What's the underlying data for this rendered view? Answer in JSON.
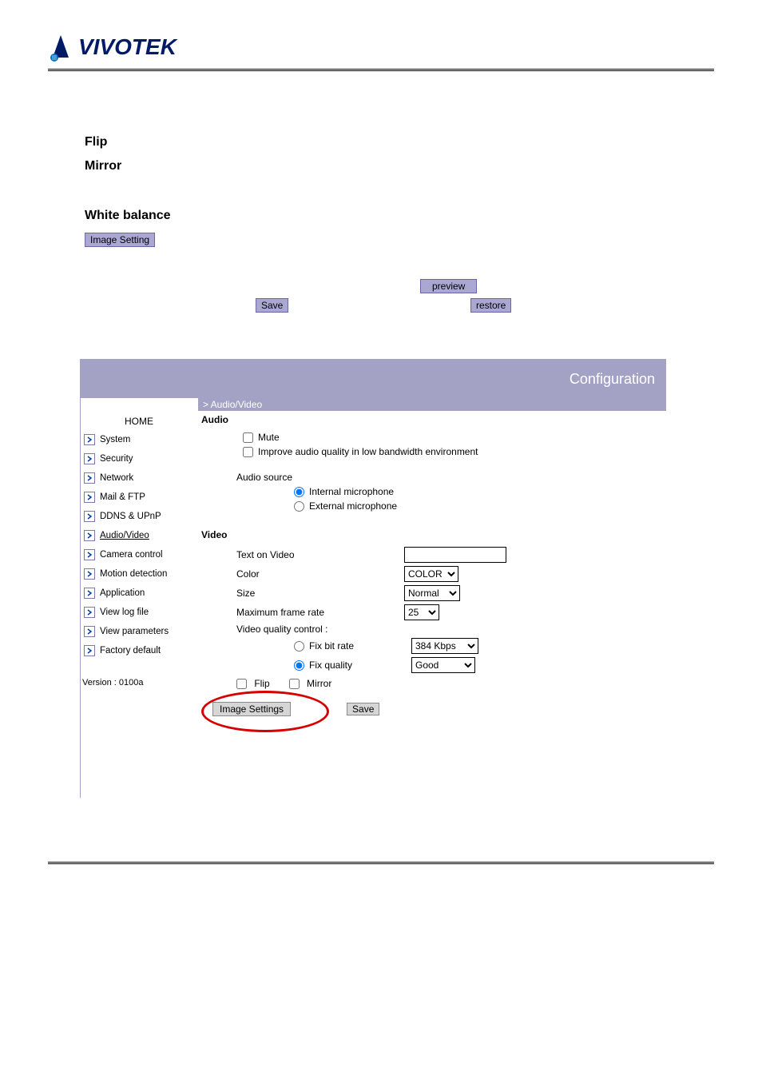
{
  "brand": "VIVOTEK",
  "doc": {
    "heading_flip": "Flip",
    "heading_mirror": "Mirror",
    "heading_wb": "White balance",
    "btn_image_setting": "Image Setting",
    "btn_save": "Save",
    "btn_preview": "preview",
    "btn_restore": "restore"
  },
  "panel": {
    "title": "Configuration",
    "breadcrumb": "> Audio/Video"
  },
  "sidebar": {
    "home": "HOME",
    "items": [
      {
        "label": "System"
      },
      {
        "label": "Security"
      },
      {
        "label": "Network"
      },
      {
        "label": "Mail & FTP"
      },
      {
        "label": "DDNS & UPnP"
      },
      {
        "label": "Audio/Video"
      },
      {
        "label": "Camera control"
      },
      {
        "label": "Motion detection"
      },
      {
        "label": "Application"
      },
      {
        "label": "View log file"
      },
      {
        "label": "View parameters"
      },
      {
        "label": "Factory default"
      }
    ],
    "version": "Version : 0100a"
  },
  "audio": {
    "section": "Audio",
    "mute": "Mute",
    "improve": "Improve audio quality in low bandwidth environment",
    "source": "Audio source",
    "internal": "Internal microphone",
    "external": "External microphone"
  },
  "video": {
    "section": "Video",
    "text_on_video": "Text on Video",
    "text_on_video_value": "",
    "color": "Color",
    "color_value": "COLOR",
    "size": "Size",
    "size_value": "Normal",
    "max_frame": "Maximum frame rate",
    "max_frame_value": "25",
    "quality_control": "Video quality control :",
    "fix_bit_rate": "Fix bit rate",
    "bit_rate_value": "384 Kbps",
    "fix_quality": "Fix quality",
    "quality_value": "Good",
    "flip": "Flip",
    "mirror": "Mirror",
    "image_settings": "Image Settings",
    "save": "Save"
  }
}
